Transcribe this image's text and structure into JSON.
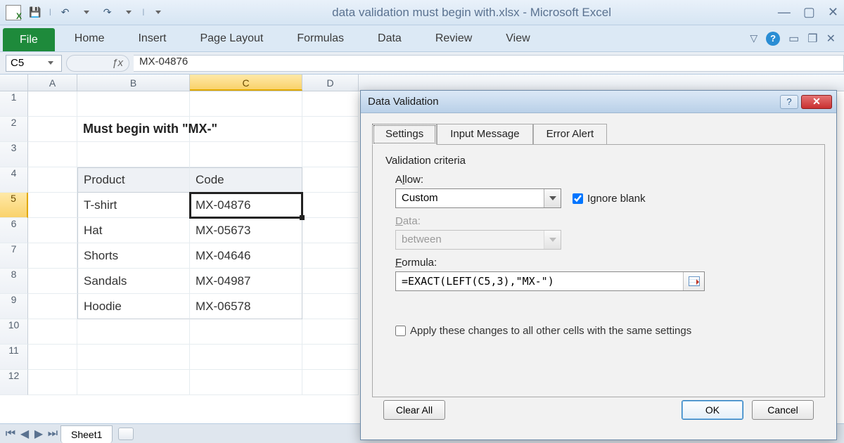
{
  "title": "data validation must begin with.xlsx  -  Microsoft Excel",
  "ribbon": {
    "file": "File",
    "tabs": [
      "Home",
      "Insert",
      "Page Layout",
      "Formulas",
      "Data",
      "Review",
      "View"
    ]
  },
  "namebox": "C5",
  "formula_bar": "MX-04876",
  "columns": [
    "A",
    "B",
    "C",
    "D"
  ],
  "sheet": {
    "title_cell": "Must begin with \"MX-\"",
    "headers": {
      "b": "Product",
      "c": "Code"
    },
    "rows": [
      {
        "b": "T-shirt",
        "c": "MX-04876"
      },
      {
        "b": "Hat",
        "c": "MX-05673"
      },
      {
        "b": "Shorts",
        "c": "MX-04646"
      },
      {
        "b": "Sandals",
        "c": "MX-04987"
      },
      {
        "b": "Hoodie",
        "c": "MX-06578"
      }
    ],
    "tab_name": "Sheet1"
  },
  "dialog": {
    "title": "Data Validation",
    "tabs": {
      "settings": "Settings",
      "input": "Input Message",
      "error": "Error Alert"
    },
    "criteria_label": "Validation criteria",
    "allow_label_pre": "A",
    "allow_label_under": "l",
    "allow_label_post": "low:",
    "allow_value": "Custom",
    "ignore_pre": "Ignore ",
    "ignore_under": "b",
    "ignore_post": "lank",
    "data_label_under": "D",
    "data_label_post": "ata:",
    "data_value": "between",
    "formula_under": "F",
    "formula_post": "ormula:",
    "formula_value": "=EXACT(LEFT(C5,3),\"MX-\")",
    "apply_row_pre": "A",
    "apply_row_under": "p",
    "apply_row_post": "ply these changes to all other cells with the same settings",
    "buttons": {
      "clear": "Clear All",
      "ok": "OK",
      "cancel": "Cancel"
    }
  }
}
